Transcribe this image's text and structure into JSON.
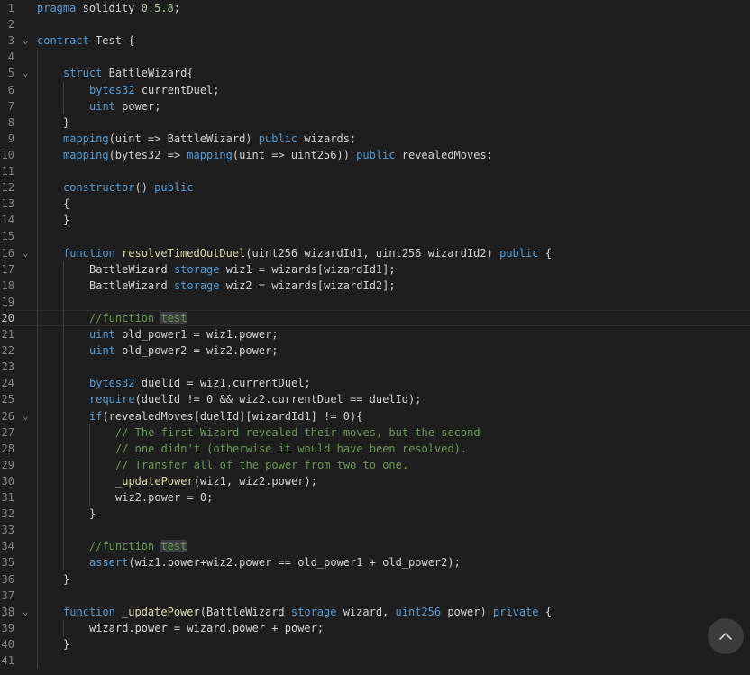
{
  "editor": {
    "lines": [
      {
        "n": "1",
        "tokens": [
          [
            "kw",
            "pragma"
          ],
          [
            "",
            "solidity"
          ],
          [
            "num",
            "0.5.8"
          ],
          [
            "",
            ";"
          ]
        ],
        "raw": "pragma solidity 0.5.8;",
        "indent": 0
      },
      {
        "n": "2",
        "tokens": [],
        "indent": 0
      },
      {
        "n": "3",
        "fold": true,
        "tokens": [
          [
            "kw",
            "contract"
          ],
          [
            "",
            "Test"
          ],
          [
            "",
            "{"
          ]
        ],
        "indent": 0
      },
      {
        "n": "4",
        "tokens": [],
        "indent": 0
      },
      {
        "n": "5",
        "fold": true,
        "tokens": [
          [
            "kw",
            "struct"
          ],
          [
            "",
            "BattleWizard{"
          ]
        ],
        "indent": 1
      },
      {
        "n": "6",
        "tokens": [
          [
            "kw",
            "bytes32"
          ],
          [
            "",
            "currentDuel;"
          ]
        ],
        "indent": 2
      },
      {
        "n": "7",
        "tokens": [
          [
            "kw",
            "uint"
          ],
          [
            "",
            "power;"
          ]
        ],
        "indent": 2
      },
      {
        "n": "8",
        "tokens": [
          [
            "",
            "}"
          ]
        ],
        "indent": 1
      },
      {
        "n": "9",
        "tokens": [
          [
            "kw",
            "mapping"
          ],
          [
            "",
            "(uint => BattleWizard)"
          ],
          [
            "kw",
            "public"
          ],
          [
            "",
            "wizards;"
          ]
        ],
        "indent": 1
      },
      {
        "n": "10",
        "tokens": [
          [
            "kw",
            "mapping"
          ],
          [
            "",
            "(bytes32 =>"
          ],
          [
            "kw",
            "mapping"
          ],
          [
            "",
            "(uint => uint256))"
          ],
          [
            "kw",
            "public"
          ],
          [
            "",
            "revealedMoves;"
          ]
        ],
        "indent": 1
      },
      {
        "n": "11",
        "tokens": [],
        "indent": 0
      },
      {
        "n": "12",
        "tokens": [
          [
            "kw",
            "constructor"
          ],
          [
            "",
            "()"
          ],
          [
            "kw",
            "public"
          ]
        ],
        "indent": 1
      },
      {
        "n": "13",
        "tokens": [
          [
            "",
            "{"
          ]
        ],
        "indent": 1
      },
      {
        "n": "14",
        "tokens": [
          [
            "",
            "}"
          ]
        ],
        "indent": 1
      },
      {
        "n": "15",
        "tokens": [],
        "indent": 0
      },
      {
        "n": "16",
        "fold": true,
        "tokens": [
          [
            "kw",
            "function"
          ],
          [
            "fn",
            "resolveTimedOutDuel"
          ],
          [
            "",
            "(uint256 wizardId1, uint256 wizardId2)"
          ],
          [
            "kw",
            "public"
          ],
          [
            "",
            "{"
          ]
        ],
        "indent": 1
      },
      {
        "n": "17",
        "tokens": [
          [
            "",
            "BattleWizard"
          ],
          [
            "kw",
            "storage"
          ],
          [
            "",
            "wiz1 = wizards[wizardId1];"
          ]
        ],
        "indent": 2
      },
      {
        "n": "18",
        "tokens": [
          [
            "",
            "BattleWizard"
          ],
          [
            "kw",
            "storage"
          ],
          [
            "",
            "wiz2 = wizards[wizardId2];"
          ]
        ],
        "indent": 2
      },
      {
        "n": "19",
        "tokens": [],
        "indent": 0
      },
      {
        "n": "20",
        "active": true,
        "tokens": [
          [
            "cm",
            "//function"
          ],
          [
            "hlcm",
            "test"
          ]
        ],
        "indent": 2
      },
      {
        "n": "21",
        "tokens": [
          [
            "kw",
            "uint"
          ],
          [
            "",
            "old_power1 = wiz1.power;"
          ]
        ],
        "indent": 2
      },
      {
        "n": "22",
        "tokens": [
          [
            "kw",
            "uint"
          ],
          [
            "",
            "old_power2 = wiz2.power;"
          ]
        ],
        "indent": 2
      },
      {
        "n": "23",
        "tokens": [],
        "indent": 0
      },
      {
        "n": "24",
        "tokens": [
          [
            "kw",
            "bytes32"
          ],
          [
            "",
            "duelId = wiz1.currentDuel;"
          ]
        ],
        "indent": 2
      },
      {
        "n": "25",
        "tokens": [
          [
            "kw",
            "require"
          ],
          [
            "",
            "(duelId != 0 && wiz2.currentDuel == duelId);"
          ]
        ],
        "indent": 2
      },
      {
        "n": "26",
        "fold": true,
        "tokens": [
          [
            "kw",
            "if"
          ],
          [
            "",
            "(revealedMoves[duelId][wizardId1] != 0){"
          ]
        ],
        "indent": 2
      },
      {
        "n": "27",
        "tokens": [
          [
            "cm",
            "// The first Wizard revealed their moves, but the second"
          ]
        ],
        "indent": 3
      },
      {
        "n": "28",
        "tokens": [
          [
            "cm",
            "// one didn't (otherwise it would have been resolved)."
          ]
        ],
        "indent": 3
      },
      {
        "n": "29",
        "tokens": [
          [
            "cm",
            "// Transfer all of the power from two to one."
          ]
        ],
        "indent": 3
      },
      {
        "n": "30",
        "tokens": [
          [
            "fn",
            "_updatePower"
          ],
          [
            "",
            "(wiz1, wiz2.power);"
          ]
        ],
        "indent": 3
      },
      {
        "n": "31",
        "tokens": [
          [
            "",
            "wiz2.power = 0;"
          ]
        ],
        "indent": 3
      },
      {
        "n": "32",
        "tokens": [
          [
            "",
            "}"
          ]
        ],
        "indent": 2
      },
      {
        "n": "33",
        "tokens": [],
        "indent": 0
      },
      {
        "n": "34",
        "tokens": [
          [
            "cm",
            "//function"
          ],
          [
            "hlcm",
            "test"
          ]
        ],
        "indent": 2
      },
      {
        "n": "35",
        "tokens": [
          [
            "kw",
            "assert"
          ],
          [
            "",
            "(wiz1.power+wiz2.power == old_power1 + old_power2);"
          ]
        ],
        "indent": 2
      },
      {
        "n": "36",
        "tokens": [
          [
            "",
            "}"
          ]
        ],
        "indent": 1
      },
      {
        "n": "37",
        "tokens": [],
        "indent": 0
      },
      {
        "n": "38",
        "fold": true,
        "tokens": [
          [
            "kw",
            "function"
          ],
          [
            "fn",
            "_updatePower"
          ],
          [
            "",
            "(BattleWizard"
          ],
          [
            "kw",
            "storage"
          ],
          [
            "",
            "wizard,"
          ],
          [
            "kw",
            "uint256"
          ],
          [
            "",
            "power)"
          ],
          [
            "kw",
            "private"
          ],
          [
            "",
            "{"
          ]
        ],
        "indent": 1
      },
      {
        "n": "39",
        "tokens": [
          [
            "",
            "wizard.power = wizard.power + power;"
          ]
        ],
        "indent": 2
      },
      {
        "n": "40",
        "tokens": [
          [
            "",
            "}"
          ]
        ],
        "indent": 1
      },
      {
        "n": "41",
        "tokens": [],
        "indent": 0
      }
    ]
  },
  "scroll_top_button": {
    "icon": "chevron-up-icon"
  }
}
